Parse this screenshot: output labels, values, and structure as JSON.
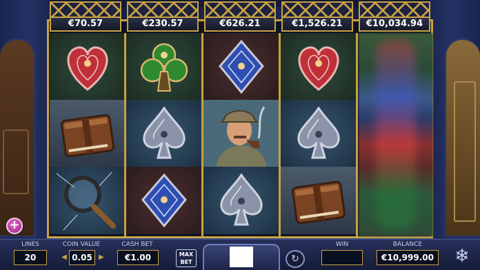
{
  "jackpots": [
    "€70.57",
    "€230.57",
    "€626.21",
    "€1,526.21",
    "€10,034.94"
  ],
  "reels": [
    [
      {
        "symbol": "heart",
        "bg": "green"
      },
      {
        "symbol": "book",
        "bg": "wood"
      },
      {
        "symbol": "magnifier",
        "bg": "blue"
      }
    ],
    [
      {
        "symbol": "club",
        "bg": "green"
      },
      {
        "symbol": "spade",
        "bg": "blue"
      },
      {
        "symbol": "diamond",
        "bg": "red"
      }
    ],
    [
      {
        "symbol": "diamond",
        "bg": "red"
      },
      {
        "symbol": "detective",
        "bg": "blue"
      },
      {
        "symbol": "spade",
        "bg": "blue"
      }
    ],
    [
      {
        "symbol": "heart",
        "bg": "green"
      },
      {
        "symbol": "spade",
        "bg": "blue"
      },
      {
        "symbol": "book",
        "bg": "wood"
      }
    ]
  ],
  "controls": {
    "lines_label": "LINES",
    "lines_value": "20",
    "coin_label": "COIN VALUE",
    "coin_value": "0.05",
    "cash_bet_label": "CASH BET",
    "cash_bet_value": "€1.00",
    "max_bet_line1": "MAX",
    "max_bet_line2": "BET",
    "win_label": "WIN",
    "win_value": "",
    "balance_label": "BALANCE",
    "balance_value": "€10,999.00"
  },
  "colors": {
    "frame_gold": "#c9a243",
    "heart": "#c0303a",
    "club": "#2f8a2f",
    "diamond": "#2f4fb0",
    "spade": "#8a93a8"
  },
  "icons": [
    "plus-icon",
    "autoplay-icon",
    "chevron-left-icon",
    "chevron-right-icon",
    "snowflake-icon"
  ]
}
